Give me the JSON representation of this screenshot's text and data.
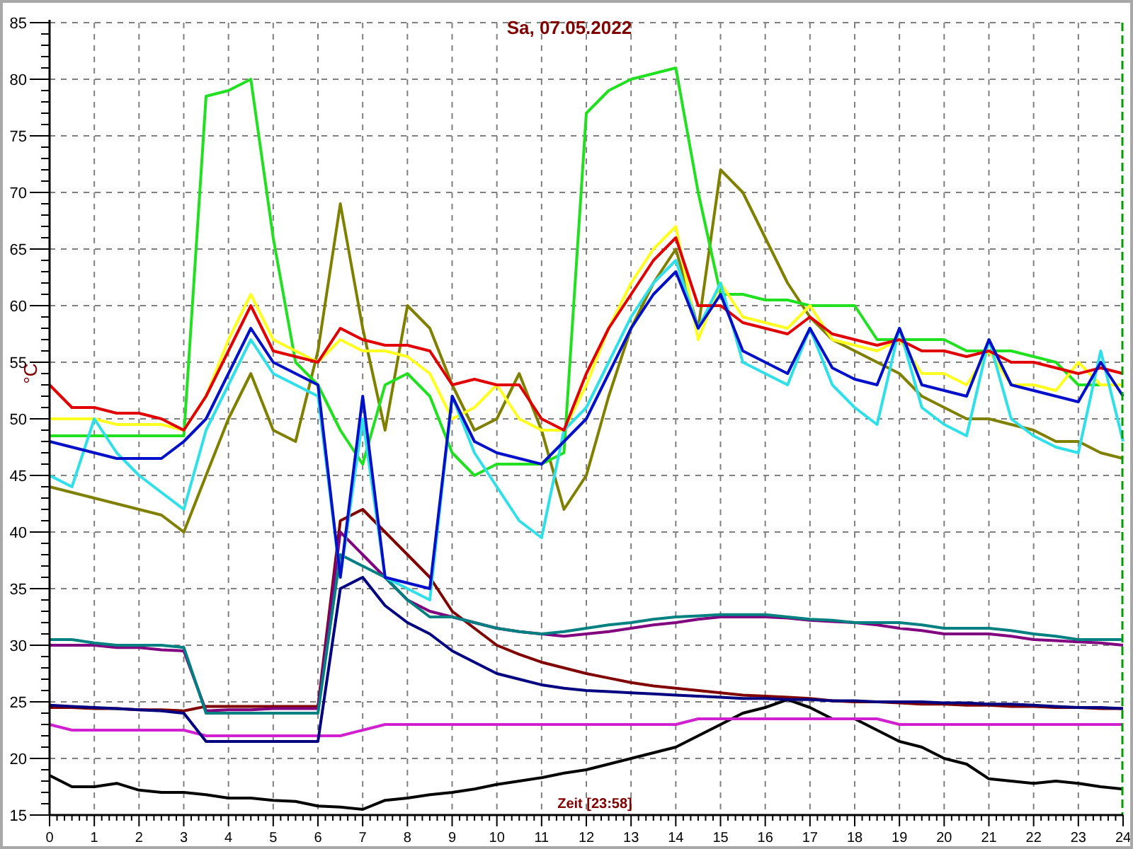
{
  "chart_data": {
    "type": "line",
    "title": "Sa, 07.05.2022",
    "xlabel": "Zeit [23:58]",
    "ylabel": "°C",
    "x": [
      0,
      0.5,
      1,
      1.5,
      2,
      2.5,
      3,
      3.5,
      4,
      4.5,
      5,
      5.5,
      6,
      6.5,
      7,
      7.5,
      8,
      8.5,
      9,
      9.5,
      10,
      10.5,
      11,
      11.5,
      12,
      12.5,
      13,
      13.5,
      14,
      14.5,
      15,
      15.5,
      16,
      16.5,
      17,
      17.5,
      18,
      18.5,
      19,
      19.5,
      20,
      20.5,
      21,
      21.5,
      22,
      22.5,
      23,
      23.5,
      24
    ],
    "xlim": [
      0,
      24
    ],
    "ylim": [
      15,
      85
    ],
    "xticks": [
      0,
      1,
      2,
      3,
      4,
      5,
      6,
      7,
      8,
      9,
      10,
      11,
      12,
      13,
      14,
      15,
      16,
      17,
      18,
      19,
      20,
      21,
      22,
      23,
      24
    ],
    "yticks": [
      15,
      20,
      25,
      30,
      35,
      40,
      45,
      50,
      55,
      60,
      65,
      70,
      75,
      80,
      85
    ],
    "series": [
      {
        "color": "#000000",
        "values": [
          18.5,
          17.5,
          17.5,
          17.8,
          17.2,
          17,
          17,
          16.8,
          16.5,
          16.5,
          16.3,
          16.2,
          15.8,
          15.7,
          15.5,
          16.3,
          16.5,
          16.8,
          17,
          17.3,
          17.7,
          18,
          18.3,
          18.7,
          19,
          19.5,
          20,
          20.5,
          21,
          22,
          23,
          24,
          24.5,
          25.2,
          24.5,
          23.5,
          23.5,
          22.5,
          21.5,
          21,
          20,
          19.5,
          18.2,
          18,
          17.8,
          18,
          17.8,
          17.5,
          17.3
        ]
      },
      {
        "color": "#d020d0",
        "values": [
          23,
          22.5,
          22.5,
          22.5,
          22.5,
          22.5,
          22.5,
          22,
          22,
          22,
          22,
          22,
          22,
          22,
          22.5,
          23,
          23,
          23,
          23,
          23,
          23,
          23,
          23,
          23,
          23,
          23,
          23,
          23,
          23,
          23.5,
          23.5,
          23.5,
          23.5,
          23.5,
          23.5,
          23.5,
          23.5,
          23.5,
          23,
          23,
          23,
          23,
          23,
          23,
          23,
          23,
          23,
          23,
          23
        ]
      },
      {
        "color": "#800000",
        "values": [
          24.5,
          24.5,
          24.4,
          24.4,
          24.3,
          24.3,
          24.2,
          24.6,
          24.6,
          24.6,
          24.6,
          24.6,
          24.6,
          41,
          42,
          40,
          38,
          36,
          33,
          31.5,
          30,
          29.2,
          28.5,
          28,
          27.5,
          27.1,
          26.7,
          26.4,
          26.2,
          26,
          25.8,
          25.6,
          25.5,
          25.4,
          25.3,
          25.1,
          25,
          25,
          24.9,
          24.8,
          24.8,
          24.7,
          24.7,
          24.6,
          24.6,
          24.5,
          24.5,
          24.4,
          24.4
        ]
      },
      {
        "color": "#000080",
        "values": [
          24.7,
          24.6,
          24.5,
          24.4,
          24.3,
          24.2,
          24,
          21.5,
          21.5,
          21.5,
          21.5,
          21.5,
          21.5,
          35,
          36,
          33.5,
          32,
          31,
          29.5,
          28.5,
          27.5,
          27,
          26.5,
          26.2,
          26,
          25.9,
          25.8,
          25.7,
          25.6,
          25.5,
          25.4,
          25.3,
          25.3,
          25.2,
          25.2,
          25.1,
          25.1,
          25,
          25,
          25,
          24.9,
          24.9,
          24.8,
          24.8,
          24.7,
          24.6,
          24.5,
          24.5,
          24.4
        ]
      },
      {
        "color": "#800080",
        "values": [
          30,
          30,
          30,
          29.8,
          29.8,
          29.6,
          29.5,
          24.2,
          24.3,
          24.3,
          24.4,
          24.4,
          24.4,
          40,
          38,
          36,
          34,
          33,
          32.5,
          32,
          31.5,
          31.2,
          31,
          30.8,
          31,
          31.2,
          31.5,
          31.8,
          32,
          32.3,
          32.5,
          32.5,
          32.5,
          32.4,
          32.2,
          32.1,
          32,
          31.8,
          31.5,
          31.3,
          31,
          31,
          31,
          30.8,
          30.5,
          30.4,
          30.3,
          30.2,
          30
        ]
      },
      {
        "color": "#008080",
        "values": [
          30.5,
          30.5,
          30.2,
          30,
          30,
          30,
          29.8,
          24,
          24,
          24,
          24,
          24,
          24,
          38,
          37,
          36,
          34,
          32.5,
          32.5,
          32,
          31.5,
          31.2,
          31,
          31.2,
          31.5,
          31.8,
          32,
          32.3,
          32.5,
          32.6,
          32.7,
          32.7,
          32.7,
          32.5,
          32.3,
          32.2,
          32,
          32,
          32,
          31.8,
          31.5,
          31.5,
          31.5,
          31.3,
          31,
          30.8,
          30.5,
          30.5,
          30.5
        ]
      },
      {
        "color": "#808000",
        "values": [
          44,
          43.5,
          43,
          42.5,
          42,
          41.5,
          40,
          45,
          50,
          54,
          49,
          48,
          56,
          69,
          58,
          49,
          60,
          58,
          53,
          49,
          50,
          54,
          49,
          42,
          45,
          52,
          58,
          62,
          65,
          58,
          72,
          70,
          66,
          62,
          59,
          57,
          56,
          55,
          54,
          52,
          51,
          50,
          50,
          49.5,
          49,
          48,
          48,
          47,
          46.5
        ]
      },
      {
        "color": "#20e020",
        "values": [
          48.5,
          48.5,
          48.5,
          48.5,
          48.5,
          48.5,
          48.5,
          78.5,
          79,
          80,
          66,
          55,
          53,
          49,
          46,
          53,
          54,
          52,
          47,
          45,
          46,
          46,
          46,
          47,
          77,
          79,
          80,
          80.5,
          81,
          70,
          61,
          61,
          60.5,
          60.5,
          60,
          60,
          60,
          57,
          57,
          57,
          57,
          56,
          56,
          56,
          55.5,
          55,
          53,
          53,
          53
        ]
      },
      {
        "color": "#ffff20",
        "values": [
          50,
          50,
          50,
          49.5,
          49.5,
          49.5,
          49,
          52,
          57,
          61,
          57,
          56,
          55,
          57,
          56,
          56,
          55.5,
          54,
          50,
          51,
          53,
          50,
          49,
          49,
          53,
          58,
          62,
          65,
          67,
          57,
          62,
          59,
          58.5,
          58,
          60,
          57,
          56.5,
          56,
          57,
          54,
          54,
          53,
          56,
          53,
          53,
          52.5,
          55,
          53,
          53
        ]
      },
      {
        "color": "#30e0e8",
        "values": [
          45,
          44,
          50,
          47,
          45,
          43.5,
          42,
          49,
          53,
          57,
          54,
          53,
          52,
          36,
          50,
          36,
          35,
          34,
          52,
          47,
          44,
          41,
          39.5,
          49,
          51,
          55,
          59,
          62,
          64,
          58,
          62,
          55,
          54,
          53,
          58,
          53,
          51,
          49.5,
          58,
          51,
          49.5,
          48.5,
          57,
          50,
          48.5,
          47.5,
          47,
          56,
          48
        ]
      },
      {
        "color": "#e00000",
        "values": [
          53,
          51,
          51,
          50.5,
          50.5,
          50,
          49,
          52,
          56,
          60,
          56,
          55.5,
          55,
          58,
          57,
          56.5,
          56.5,
          56,
          53,
          53.5,
          53,
          53,
          50,
          49,
          54,
          58,
          61,
          64,
          66,
          60,
          60,
          58.5,
          58,
          57.5,
          59,
          57.5,
          57,
          56.5,
          57,
          56,
          56,
          55.5,
          56,
          55,
          55,
          54.5,
          54,
          54.5,
          54
        ]
      },
      {
        "color": "#0010c8",
        "values": [
          48,
          47.5,
          47,
          46.5,
          46.5,
          46.5,
          48,
          50,
          54,
          58,
          55,
          54,
          53,
          36,
          52,
          36,
          35.5,
          35,
          52,
          48,
          47,
          46.5,
          46,
          48,
          50,
          54,
          58,
          61,
          63,
          58,
          61,
          56,
          55,
          54,
          58,
          54.5,
          53.5,
          53,
          58,
          53,
          52.5,
          52,
          57,
          53,
          52.5,
          52,
          51.5,
          55,
          52
        ]
      }
    ],
    "grid": true
  }
}
